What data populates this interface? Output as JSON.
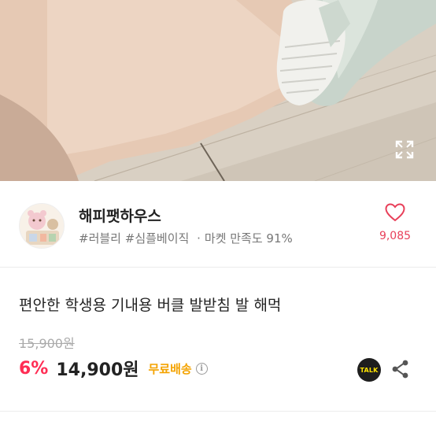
{
  "hero": {
    "expand_icon": "expand-icon"
  },
  "seller": {
    "avatar_icon": "shop-avatar",
    "name": "해피팻하우스",
    "tag1": "#러블리",
    "tag2": "#심플베이직",
    "separator": "·",
    "satisfaction": "마켓 만족도 91%",
    "like_icon": "heart-outline-icon",
    "like_count": "9,085"
  },
  "product": {
    "title": "편안한 학생용 기내용 버클 발받침 발 해먹",
    "original_price": "15,900원",
    "discount": "6%",
    "price": "14,900원",
    "shipping": "무료배송",
    "info_icon": "i"
  },
  "actions": {
    "talk_label": "TALK",
    "share_icon": "share-icon"
  },
  "colors": {
    "accent_pink": "#ff2d54",
    "heart": "#e8405a",
    "shipping": "#f4a300"
  }
}
